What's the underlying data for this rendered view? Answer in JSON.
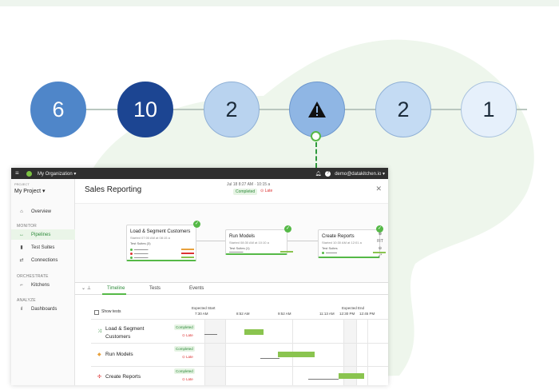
{
  "steps": [
    "6",
    "10",
    "2",
    "2",
    "1"
  ],
  "warning_icon": "warning-triangle-icon",
  "app": {
    "org_label": "My Organization",
    "user_email": "demo@datakitchen.io",
    "project_label": "PROJECT",
    "project": "My Project",
    "nav": [
      {
        "section": "",
        "items": [
          {
            "label": "Overview",
            "icon": "home-icon",
            "glyph": "⌂",
            "active": false
          }
        ]
      },
      {
        "section": "MONITOR",
        "items": [
          {
            "label": "Pipelines",
            "icon": "pipeline-icon",
            "glyph": "↔",
            "active": true
          },
          {
            "label": "Test Suites",
            "icon": "test-suite-icon",
            "glyph": "▮",
            "active": false
          },
          {
            "label": "Connections",
            "icon": "connections-icon",
            "glyph": "⇄",
            "active": false
          }
        ]
      },
      {
        "section": "ORCHESTRATE",
        "items": [
          {
            "label": "Kitchens",
            "icon": "kitchen-icon",
            "glyph": "⌐",
            "active": false
          }
        ]
      },
      {
        "section": "ANALYZE",
        "items": [
          {
            "label": "Dashboards",
            "icon": "dashboard-icon",
            "glyph": "ıl",
            "active": false
          }
        ]
      }
    ],
    "page_title": "Sales Reporting",
    "run_meta": "Jul 18 8:27 AM · 10:15 a",
    "status_completed": "Completed",
    "status_late": "Late",
    "nodes": [
      {
        "title": "Load & Segment Customers",
        "sub": "Started 07:00 AM at 08:15 a",
        "sets": "Test Suites (3)"
      },
      {
        "title": "Run Models",
        "sub": "Started 08:30 AM at 10:10 a",
        "sets": "Test Suites (1)"
      },
      {
        "title": "Create Reports",
        "sub": "Started 10:30 AM at 12:01 a",
        "sets": "Test Suites"
      }
    ],
    "zoom": {
      "zoom_in": "⊕",
      "fit": "FIT",
      "zoom_out": "⊖",
      "expand": "⤢"
    },
    "tabs": [
      "Timeline",
      "Tests",
      "Events"
    ],
    "timeline": {
      "show_tests": "Show tests",
      "expected_start": "Expected Start",
      "expected_end": "Expected End",
      "ticks": [
        "7:30 AM",
        "8:52 AM",
        "9:52 AM",
        "11:13 AM",
        "12:30 PM",
        "12:45 PM"
      ],
      "rows": [
        {
          "name_line1": "Load & Segment",
          "name_line2": "Customers",
          "status": "Completed",
          "late": "Late"
        },
        {
          "name_line1": "Run Models",
          "name_line2": "",
          "status": "Completed",
          "late": "Late"
        },
        {
          "name_line1": "Create Reports",
          "name_line2": "",
          "status": "Completed",
          "late": "Late"
        }
      ]
    }
  }
}
